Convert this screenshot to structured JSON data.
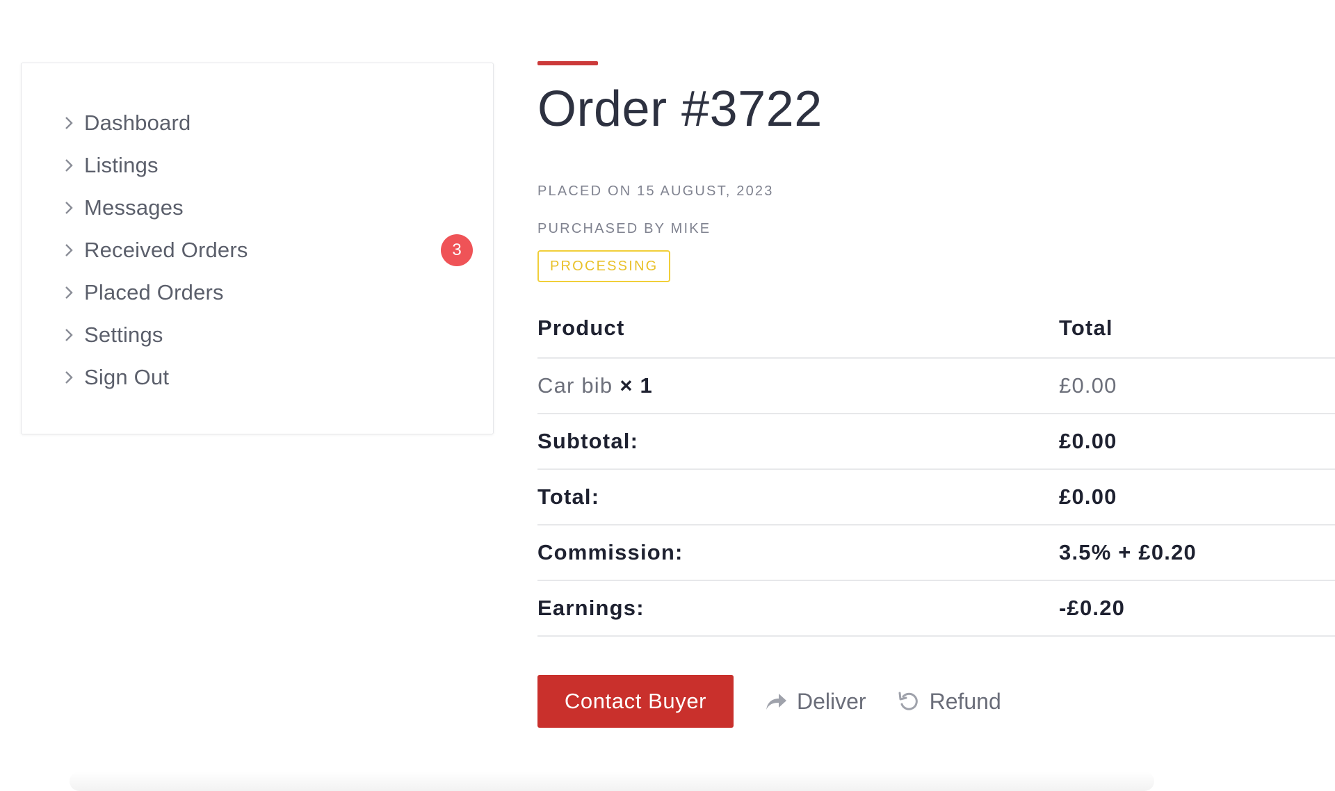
{
  "sidebar": {
    "items": [
      {
        "label": "Dashboard"
      },
      {
        "label": "Listings"
      },
      {
        "label": "Messages"
      },
      {
        "label": "Received Orders",
        "badge": "3"
      },
      {
        "label": "Placed Orders"
      },
      {
        "label": "Settings"
      },
      {
        "label": "Sign Out"
      }
    ]
  },
  "order": {
    "title": "Order #3722",
    "placed_on": "PLACED ON 15 AUGUST, 2023",
    "purchased_by": "PURCHASED BY MIKE",
    "status": "PROCESSING"
  },
  "table": {
    "headers": {
      "product": "Product",
      "total": "Total"
    },
    "item": {
      "name": "Car bib",
      "qty": "× 1",
      "total": "£0.00"
    },
    "rows": [
      {
        "label": "Subtotal:",
        "value": "£0.00"
      },
      {
        "label": "Total:",
        "value": "£0.00"
      },
      {
        "label": "Commission:",
        "value": "3.5% + £0.20"
      },
      {
        "label": "Earnings:",
        "value": "-£0.20"
      }
    ]
  },
  "actions": {
    "contact": "Contact Buyer",
    "deliver": "Deliver",
    "refund": "Refund"
  },
  "colors": {
    "accent": "#cc3a3a",
    "button": "#c9302c",
    "badge": "#ef5357",
    "status": "#e9c129"
  },
  "icons": {
    "nav": "chevron-right-icon",
    "deliver": "share-arrow-icon",
    "refund": "undo-icon"
  }
}
